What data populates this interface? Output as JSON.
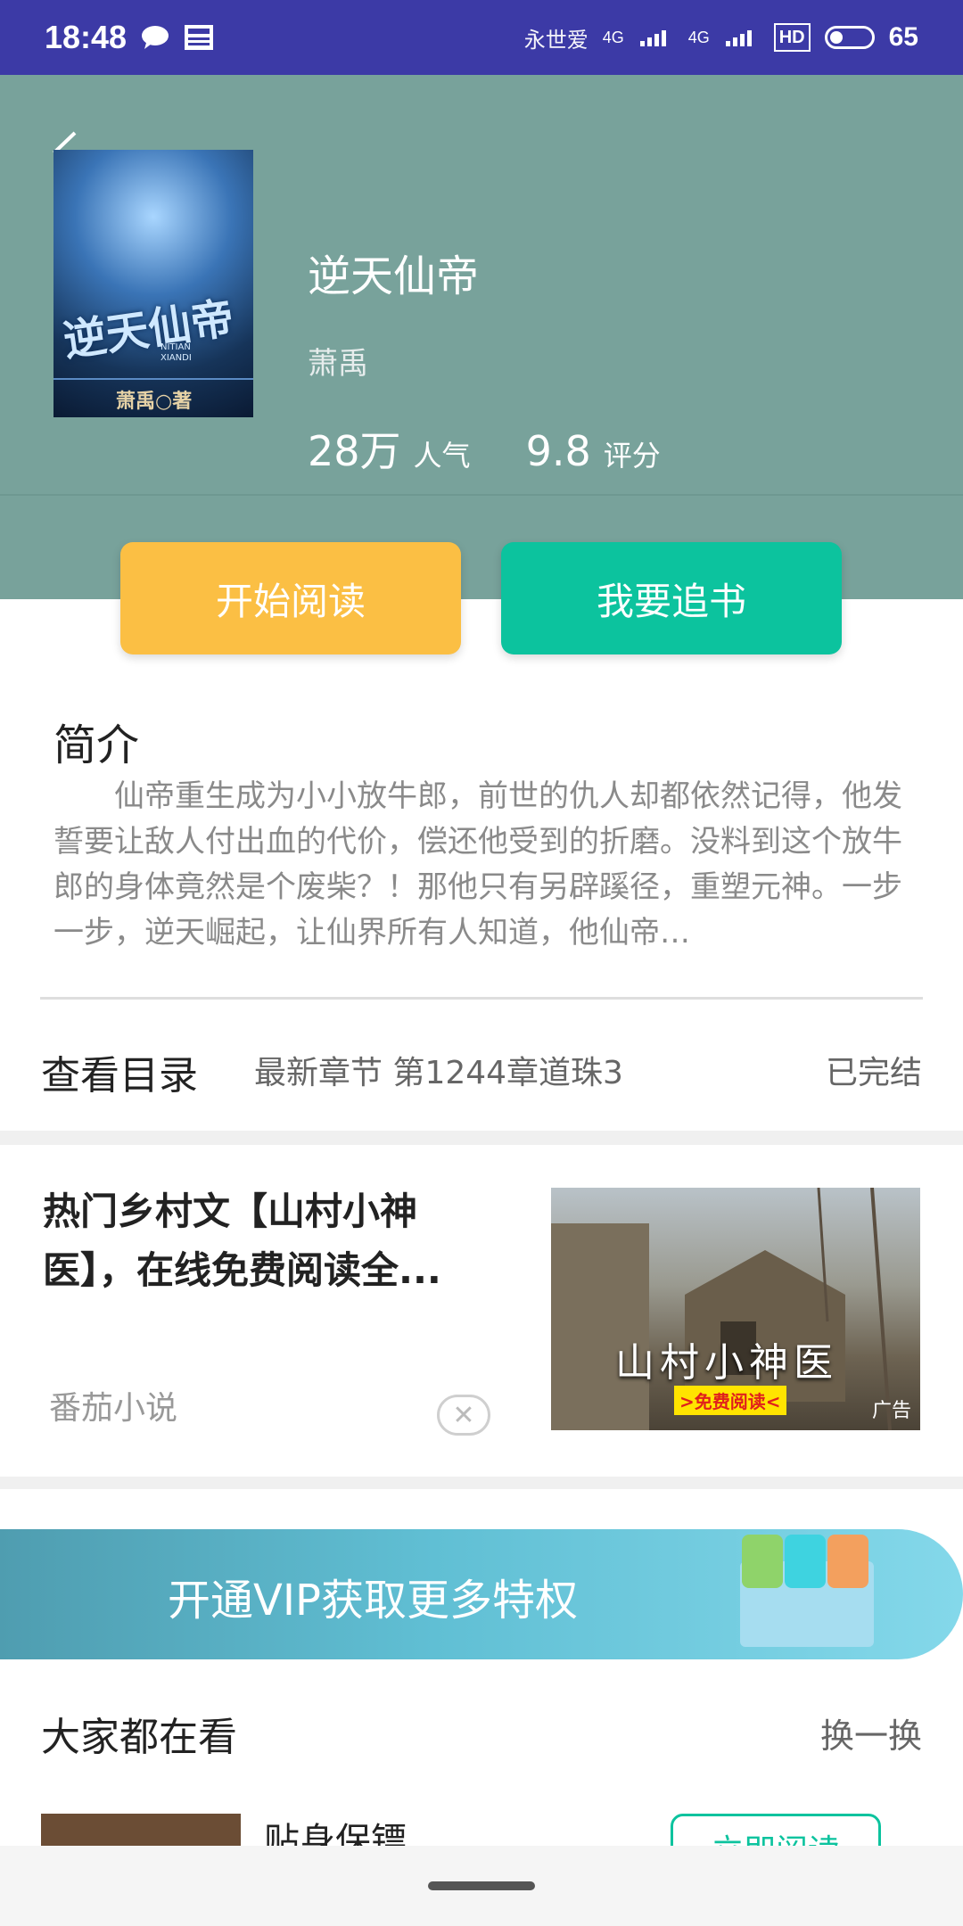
{
  "status_bar": {
    "time": "18:48",
    "deco_text": "永世爱",
    "network": "4G",
    "hd": "HD",
    "battery": "65"
  },
  "book": {
    "title": "逆天仙帝",
    "author": "萧禹",
    "popularity_value": "28万",
    "popularity_label": "人气",
    "rating_value": "9.8",
    "rating_label": "评分",
    "cover": {
      "title": "逆天仙帝",
      "pinyin_line1": "NITIAN",
      "pinyin_line2": "XIANDI",
      "author": "萧禹○著"
    }
  },
  "buttons": {
    "start_reading": "开始阅读",
    "follow_book": "我要追书"
  },
  "intro": {
    "heading": "简介",
    "text": "仙帝重生成为小小放牛郎，前世的仇人却都依然记得，他发誓要让敌人付出血的代价，偿还他受到的折磨。没料到这个放牛郎的身体竟然是个废柴？！那他只有另辟蹊径，重塑元神。一步一步，逆天崛起，让仙界所有人知道，他仙帝…"
  },
  "toc": {
    "label": "查看目录",
    "latest": "最新章节 第1244章道珠3",
    "status": "已完结"
  },
  "ad": {
    "title": "热门乡村文【山村小神医】，在线免费阅读全...",
    "source": "番茄小说",
    "image_title": "山村小神医",
    "image_cta": ">免费阅读<",
    "image_tag": "广告"
  },
  "vip": {
    "text": "开通VIP获取更多特权"
  },
  "popular": {
    "title": "大家都在看",
    "swap": "换一换",
    "items": [
      {
        "title": "贴身保镖",
        "button": "立即阅读"
      }
    ]
  },
  "colors": {
    "status_bar": "#3c3aa6",
    "hero": "#78a29b",
    "read_button": "#fbbf44",
    "follow_button": "#0cc39e"
  }
}
